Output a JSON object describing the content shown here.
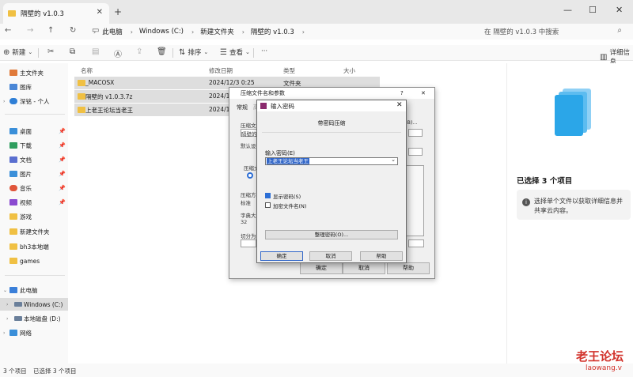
{
  "window": {
    "tab_title": "隔壁的 v1.0.3",
    "tab_close": "✕",
    "new_tab": "+",
    "minimize": "—",
    "maximize": "☐",
    "close": "✕"
  },
  "address": {
    "crumbs": [
      "此电脑",
      "Windows (C:)",
      "新建文件夹",
      "隔壁的 v1.0.3"
    ],
    "separator": "›",
    "search_placeholder": "在 隔壁的 v1.0.3 中搜索"
  },
  "toolbar": {
    "new_label": "新建",
    "sort_label": "排序",
    "view_label": "查看",
    "more_label": "···",
    "details_label": "详细信息"
  },
  "sidebar": {
    "items": [
      {
        "label": "主文件夹",
        "icon": "home-icon",
        "color": "#e07a3a"
      },
      {
        "label": "图库",
        "icon": "gallery-icon",
        "color": "#4a86d6"
      },
      {
        "label": "深铭 - 个人",
        "icon": "cloud-icon",
        "color": "#2f7fd6"
      },
      {
        "label": "桌面",
        "icon": "desktop-icon",
        "color": "#3a8fd9"
      },
      {
        "label": "下载",
        "icon": "download-icon",
        "color": "#2f9e5f"
      },
      {
        "label": "文档",
        "icon": "document-icon",
        "color": "#5a6fd0"
      },
      {
        "label": "图片",
        "icon": "pictures-icon",
        "color": "#3a8fd9"
      },
      {
        "label": "音乐",
        "icon": "music-icon",
        "color": "#e0553a"
      },
      {
        "label": "视频",
        "icon": "video-icon",
        "color": "#8a4ad0"
      },
      {
        "label": "游戏",
        "icon": "folder-icon",
        "color": "#f0c043"
      },
      {
        "label": "新建文件夹",
        "icon": "folder-icon",
        "color": "#f0c043"
      },
      {
        "label": "bh3本地端",
        "icon": "folder-icon",
        "color": "#f0c043"
      },
      {
        "label": "games",
        "icon": "folder-icon",
        "color": "#f0c043"
      },
      {
        "label": "此电脑",
        "icon": "computer-icon",
        "color": "#3a7fd9"
      },
      {
        "label": "Windows (C:)",
        "icon": "drive-icon",
        "color": "#6a7f9a"
      },
      {
        "label": "本地磁盘 (D:)",
        "icon": "drive-icon",
        "color": "#6a7f9a"
      },
      {
        "label": "网络",
        "icon": "network-icon",
        "color": "#3a8fd9"
      }
    ]
  },
  "filelist": {
    "headers": {
      "name": "名称",
      "date": "修改日期",
      "type": "类型",
      "size": "大小"
    },
    "rows": [
      {
        "name": "_MACOSX",
        "date": "2024/12/3 0:25",
        "type": "文件夹"
      },
      {
        "name": "隔壁的 v1.0.3.7z",
        "date": "2024/1",
        "type": ""
      },
      {
        "name": "上老王论坛当老王",
        "date": "2024/1",
        "type": ""
      }
    ]
  },
  "details": {
    "title": "已选择 3 个项目",
    "message": "选择单个文件以获取详细信息并共享云内容。"
  },
  "status": {
    "count": "3 个项目",
    "selected": "已选择 3 个项目",
    "watermark_cn": "老王论坛",
    "watermark_url": "laowang.v"
  },
  "archive_dialog": {
    "title": "压缩文件名和参数",
    "help": "?",
    "close": "✕",
    "tab_general": "常规",
    "tab_advanced": "高",
    "labels": [
      "压缩文",
      "隔壁的",
      "默认设",
      "压缩文",
      "压缩方",
      "标准",
      "字典大小",
      "32",
      "切分为"
    ],
    "right_hint": "(B)...",
    "ok": "确定",
    "cancel": "取消",
    "help_btn": "帮助"
  },
  "password_dialog": {
    "title": "输入密码",
    "close": "✕",
    "header": "带密码压缩",
    "input_label": "输入密码(E)",
    "password_value": "上老王论坛当老王",
    "dropdown": "⌄",
    "show_password": "显示密码(S)",
    "encrypt_names": "加密文件名(N)",
    "manage_button": "整理密码(O)...",
    "ok": "确定",
    "cancel": "取消",
    "help": "帮助",
    "show_password_checked": true,
    "encrypt_names_checked": false
  }
}
